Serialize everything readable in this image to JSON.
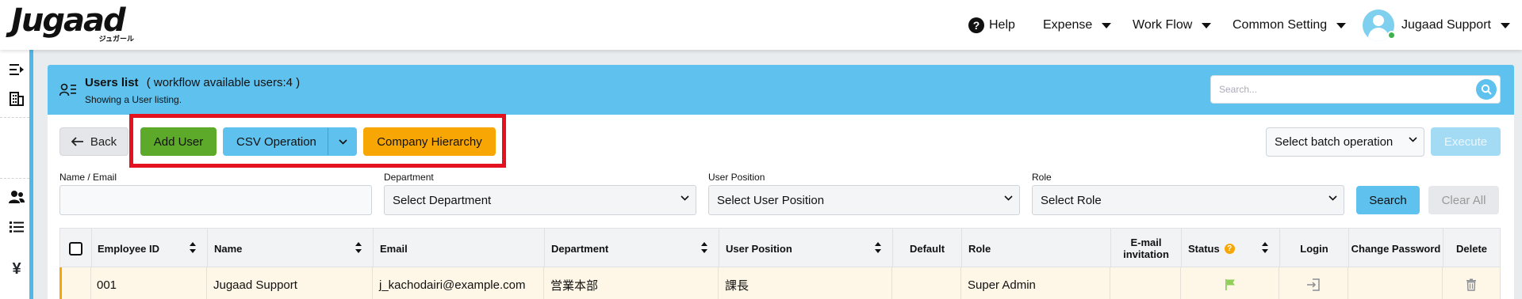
{
  "app": {
    "logo_text": "Jugaad",
    "logo_subtext": "ジュガール"
  },
  "nav": {
    "help_label": "Help",
    "expense_label": "Expense",
    "workflow_label": "Work Flow",
    "common_setting_label": "Common Setting",
    "user_name": "Jugaad Support"
  },
  "sidebar": {
    "icons": [
      "collapse-menu-icon",
      "building-icon",
      "users-icon",
      "list-icon",
      "yen-icon"
    ]
  },
  "page": {
    "title": "Users list",
    "title_suffix": "( workflow available users:4 )",
    "subtitle": "Showing a User listing.",
    "search_placeholder": "Search..."
  },
  "toolbar": {
    "back_label": "Back",
    "add_user_label": "Add User",
    "csv_label": "CSV Operation",
    "hierarchy_label": "Company Hierarchy",
    "batch_placeholder": "Select batch operation",
    "execute_label": "Execute"
  },
  "filters": {
    "name_email_label": "Name / Email",
    "name_email_value": "",
    "department_label": "Department",
    "department_value": "Select Department",
    "position_label": "User Position",
    "position_value": "Select User Position",
    "role_label": "Role",
    "role_value": "Select Role",
    "search_label": "Search",
    "clear_label": "Clear All"
  },
  "table": {
    "columns": [
      "Employee ID",
      "Name",
      "Email",
      "Department",
      "User Position",
      "Default",
      "Role",
      "E-mail invitation",
      "Status",
      "Login",
      "Change Password",
      "Delete"
    ],
    "rows": [
      {
        "employee_id": "001",
        "name": "Jugaad Support",
        "email": "j_kachodairi@example.com",
        "department": "営業本部",
        "position": "課長",
        "default": "",
        "role": "Super Admin",
        "invitation": ""
      }
    ]
  },
  "colors": {
    "header_blue": "#5ec1ee",
    "add_green": "#5daa2b",
    "hierarchy_orange": "#f8a603",
    "highlight_red": "#e3121e"
  }
}
